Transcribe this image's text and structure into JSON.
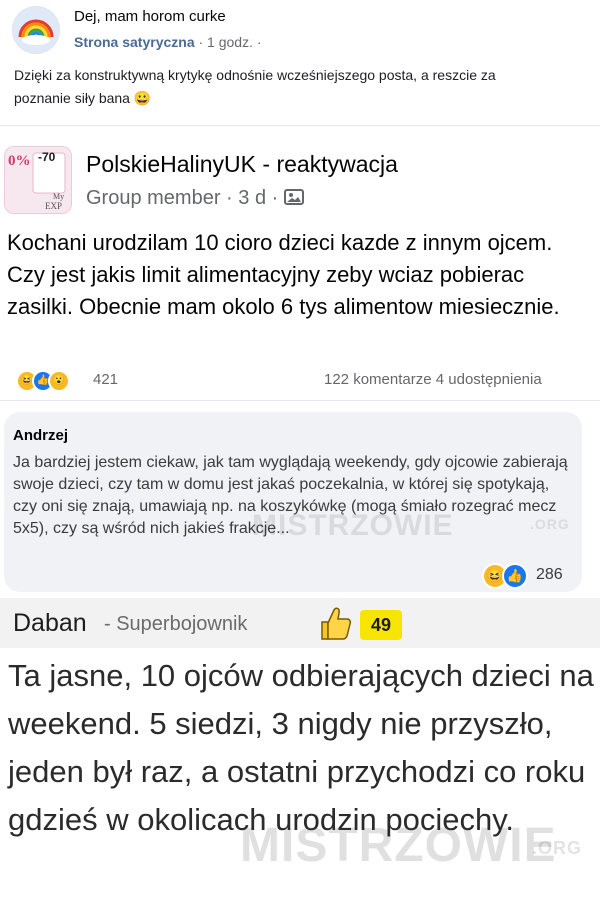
{
  "post1": {
    "author": "Dej, mam horom curke",
    "group": "Strona satyryczna",
    "time": "· 1 godz. ·",
    "text": "Dzięki za konstruktywną krytykę odnośnie wcześniejszego posta, a reszcie za poznanie siły bana",
    "emoji": "😀"
  },
  "post2": {
    "group_name": "PolskieHalinyUK - reaktywacja",
    "meta": "Group member · 3 d ·",
    "text": "Kochani urodzilam 10 cioro dzieci kazde z innym ojcem. Czy jest jakis limit alimentacyjny zeby wciaz pobierac zasilki. Obecnie mam okolo 6 tys alimentow miesiecznie.",
    "reaction_count": "421",
    "comments": "122 komentarze",
    "shares": "4 udostępnienia",
    "avatar_text": {
      "t1": "0%",
      "t2": "-70",
      "t3": "My",
      "t4": "EXP"
    }
  },
  "comment": {
    "author": "Andrzej",
    "text": "Ja bardziej jestem ciekaw, jak tam wyglądają weekendy, gdy ojcowie zabierają swoje dzieci, czy tam w domu jest jakaś poczekalnia, w której się spotykają, czy oni się znają, umawiają np. na koszykówkę (mogą śmiało rozegrać mecz 5x5), czy są wśród nich jakieś frakcje...",
    "reaction_count": "286"
  },
  "post4": {
    "author": "Daban",
    "rank": "- Superbojownik",
    "score": "49",
    "text": "Ta jasne, 10 ojców odbierających dzieci na weekend. 5 siedzi, 3 nigdy nie przyszło, jeden był raz, a ostatni przychodzi co roku gdzieś w okolicach urodzin pociechy."
  },
  "watermark": {
    "text": "MISTRZOWIE",
    "suffix": ".ORG"
  },
  "colors": {
    "like_blue": "#1877f2",
    "haha_yellow": "#f7b928",
    "score_yellow": "#f7e400"
  }
}
